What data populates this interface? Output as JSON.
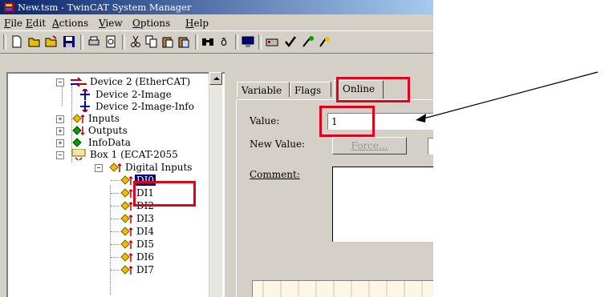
{
  "window": {
    "title": "New.tsm - TwinCAT System Manager"
  },
  "menu": [
    {
      "key": "F",
      "rest": "ile"
    },
    {
      "key": "E",
      "rest": "dit"
    },
    {
      "key": "A",
      "rest": "ctions"
    },
    {
      "key": "V",
      "rest": "iew"
    },
    {
      "key": "O",
      "rest": "ptions"
    },
    {
      "key": "H",
      "rest": "elp"
    }
  ],
  "toolbar": {
    "icons": [
      "new-icon",
      "open-icon",
      "open-alt-icon",
      "save-icon",
      "print-icon",
      "print-preview-icon",
      "cut-icon",
      "copy-icon",
      "paste-icon",
      "paste-special-icon",
      "find-icon",
      "variable-icon",
      "monitor-icon",
      "device-icon",
      "check-icon",
      "activate-icon",
      "debug-icon"
    ]
  },
  "tree": {
    "device": "Device 2 (EtherCAT)",
    "image": "Device 2-Image",
    "image_info": "Device 2-Image-Info",
    "inputs": "Inputs",
    "outputs": "Outputs",
    "infodata": "InfoData",
    "box": "Box 1 (ECAT-2055",
    "digital_inputs": "Digital Inputs",
    "items": [
      "DI0",
      "DI1",
      "DI2",
      "DI3",
      "DI4",
      "DI5",
      "DI6",
      "DI7"
    ]
  },
  "tabs": {
    "variable": "Variable",
    "flags": "Flags",
    "online": "Online"
  },
  "online": {
    "value_label": "Value:",
    "value": "1",
    "new_value_label": "New Value:",
    "force_button": "Force...",
    "comment_label": "Comment:",
    "comment_value": ""
  },
  "colors": {
    "highlight": "#e3001b",
    "face": "#d4d0c8",
    "title_start": "#0a246a"
  }
}
